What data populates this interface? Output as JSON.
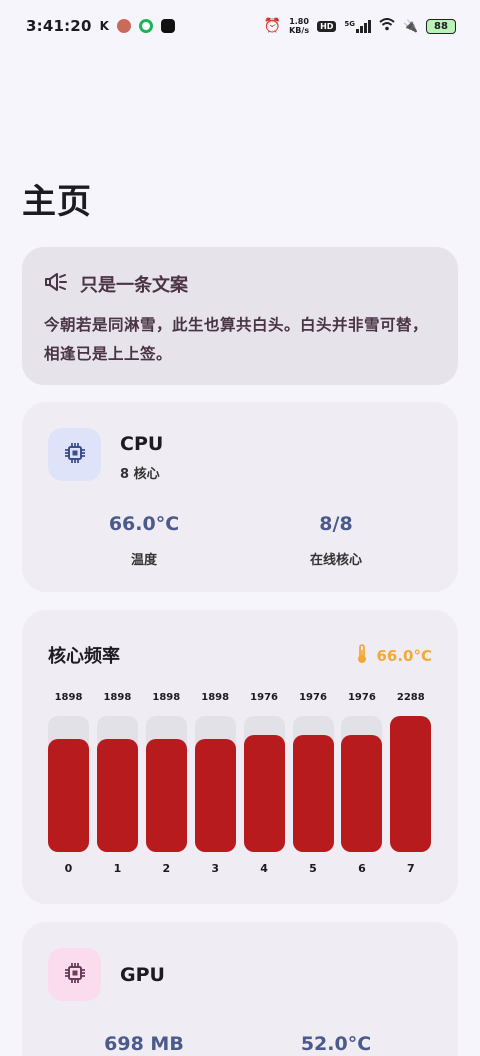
{
  "status_bar": {
    "time": "3:41:20",
    "net_speed_value": "1.80",
    "net_speed_unit": "KB/s",
    "hd": "HD",
    "signal": "5G",
    "battery": "88"
  },
  "page_title": "主页",
  "quote": {
    "title": "只是一条文案",
    "text": "今朝若是同淋雪，此生也算共白头。白头并非雪可替，相逢已是上上签。"
  },
  "cpu": {
    "title": "CPU",
    "cores": "8 核心",
    "temperature_value": "66.0°C",
    "temperature_label": "温度",
    "online_value": "8/8",
    "online_label": "在线核心",
    "tile_color": "#dfe3fa"
  },
  "core_freq": {
    "title": "核心频率",
    "temperature": "66.0°C",
    "bar_color": "#b81b1e",
    "max_freq": 2288,
    "cores": [
      {
        "index": "0",
        "freq": "1898",
        "value": 1898
      },
      {
        "index": "1",
        "freq": "1898",
        "value": 1898
      },
      {
        "index": "2",
        "freq": "1898",
        "value": 1898
      },
      {
        "index": "3",
        "freq": "1898",
        "value": 1898
      },
      {
        "index": "4",
        "freq": "1976",
        "value": 1976
      },
      {
        "index": "5",
        "freq": "1976",
        "value": 1976
      },
      {
        "index": "6",
        "freq": "1976",
        "value": 1976
      },
      {
        "index": "7",
        "freq": "2288",
        "value": 2288
      }
    ]
  },
  "gpu": {
    "title": "GPU",
    "memory": "698 MB",
    "temperature": "52.0°C",
    "tile_color": "#fbdcef"
  }
}
